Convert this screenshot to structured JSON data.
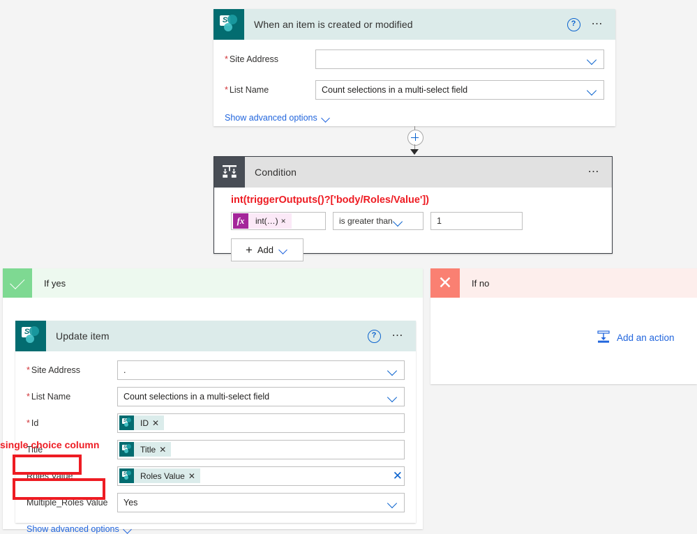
{
  "trigger_card": {
    "icon": "sharepoint-icon",
    "title": "When an item is created or modified",
    "help_icon": "help-icon",
    "more_icon": "ellipsis-icon",
    "fields": [
      {
        "label": "Site Address",
        "required": true,
        "value": "",
        "control": "dropdown"
      },
      {
        "label": "List Name",
        "required": true,
        "value": "Count selections in a multi-select field",
        "control": "dropdown"
      }
    ],
    "advanced_link": "Show advanced options"
  },
  "connector": {
    "plus_icon": "add-step-icon",
    "arrow_icon": "arrow-down-icon"
  },
  "condition_card": {
    "icon": "condition-icon",
    "title": "Condition",
    "more_icon": "ellipsis-icon",
    "expression_annotation": "int(triggerOutputs()?['body/Roles/Value'])",
    "operand_token": {
      "fx": "fx",
      "text": "int(…)",
      "remove": "×"
    },
    "operator": "is greater than",
    "compare_value": "1",
    "add_button": {
      "plus": "+",
      "label": "Add",
      "chevron": "chevron-down-icon"
    }
  },
  "if_yes": {
    "icon": "check-icon",
    "title": "If yes",
    "update_card": {
      "icon": "sharepoint-icon",
      "title": "Update item",
      "help_icon": "help-icon",
      "more_icon": "ellipsis-icon",
      "fields": [
        {
          "label": "Site Address",
          "required": true,
          "value": ".",
          "control": "dropdown"
        },
        {
          "label": "List Name",
          "required": true,
          "value": "Count selections in a multi-select field",
          "control": "dropdown"
        },
        {
          "label": "Id",
          "required": true,
          "token": "ID",
          "control": "token"
        },
        {
          "label": "Title",
          "required": false,
          "token": "Title",
          "control": "token"
        },
        {
          "label": "Roles Value",
          "required": false,
          "token": "Roles Value",
          "control": "token-clear"
        },
        {
          "label": "Multiple_Roles Value",
          "required": false,
          "value": "Yes",
          "control": "dropdown"
        }
      ],
      "advanced_link": "Show advanced options"
    }
  },
  "if_no": {
    "icon": "close-icon",
    "title": "If no",
    "add_action": {
      "icon": "add-action-icon",
      "label": "Add an action"
    }
  },
  "annotations": {
    "note": "single choice column",
    "color": "#ee1c23",
    "boxes": [
      "Roles Value",
      "Multiple_Roles Value"
    ]
  },
  "colors": {
    "sharepoint_teal": "#036c70",
    "header_teal": "#dcebea",
    "condition_dark": "#484d55",
    "condition_header": "#e1e1e1",
    "yes_green": "#7ed992",
    "no_red": "#fa8072",
    "link_blue": "#2266dd",
    "annotation_red": "#ee1c23",
    "page_bg": "#f4f4f4"
  }
}
